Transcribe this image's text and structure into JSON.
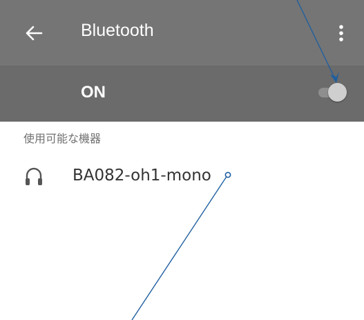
{
  "app_bar": {
    "back_icon": "back-arrow-icon",
    "title": "Bluetooth",
    "overflow_icon": "more-vert-icon"
  },
  "toggle_row": {
    "label": "ON",
    "toggle_state": "on"
  },
  "available_devices": {
    "header": "使用可能な機器",
    "items": [
      {
        "icon": "headset-icon",
        "name": "BA082-oh1-mono"
      }
    ]
  },
  "colors": {
    "app_bar": "#757575",
    "toggle_bar": "#6b6b6b",
    "annotation_line": "#1f5fa0"
  }
}
